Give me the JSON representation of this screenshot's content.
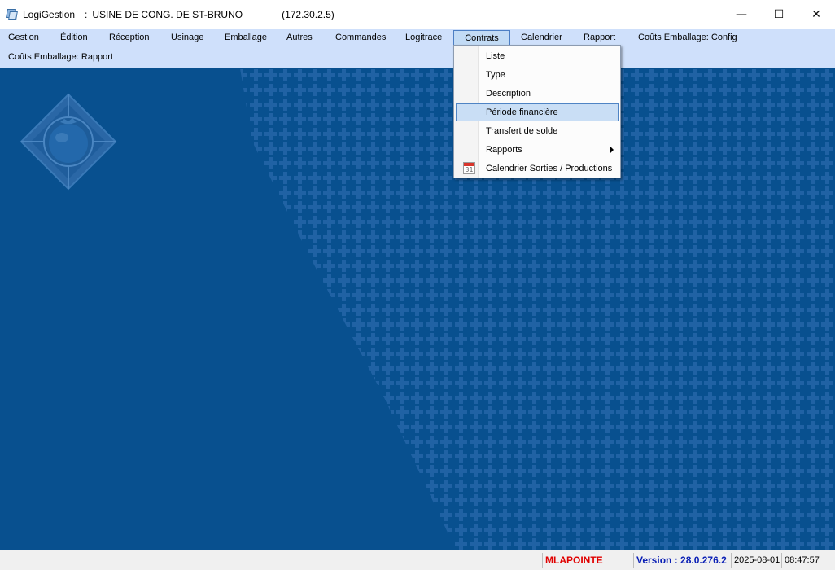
{
  "window": {
    "app_name": "LogiGestion",
    "separator": ":",
    "company": "USINE DE CONG. DE ST-BRUNO",
    "ip": "(172.30.2.5)",
    "controls": {
      "minimize": "—",
      "maximize": "☐",
      "close": "✕"
    }
  },
  "menu": {
    "items": [
      {
        "label": "Gestion"
      },
      {
        "label": "Édition"
      },
      {
        "label": "Réception"
      },
      {
        "label": "Usinage"
      },
      {
        "label": "Emballage"
      },
      {
        "label": "Autres"
      },
      {
        "label": "Commandes"
      },
      {
        "label": "Logitrace"
      },
      {
        "label": "Contrats"
      },
      {
        "label": "Calendrier"
      },
      {
        "label": "Rapport"
      },
      {
        "label": "Coûts Emballage: Config"
      },
      {
        "label": "Coûts Emballage: Rapport"
      }
    ],
    "active": "Contrats"
  },
  "contrats_menu": {
    "items": [
      {
        "label": "Liste"
      },
      {
        "label": "Type"
      },
      {
        "label": "Description"
      },
      {
        "label": "Période financière",
        "highlighted": true
      },
      {
        "label": "Transfert de solde"
      },
      {
        "label": "Rapports",
        "submenu": true
      },
      {
        "label": "Calendrier Sorties / Productions",
        "icon": "calendar-icon",
        "icon_text": "31"
      }
    ]
  },
  "status": {
    "user": "MLAPOINTE",
    "version_label": "Version :",
    "version": "28.0.276.2",
    "date": "2025-08-01",
    "time": "08:47:57"
  },
  "colors": {
    "background": "#08508f",
    "menubar": "#cfe0fb",
    "user": "#e00000",
    "version": "#0a1fb5"
  }
}
